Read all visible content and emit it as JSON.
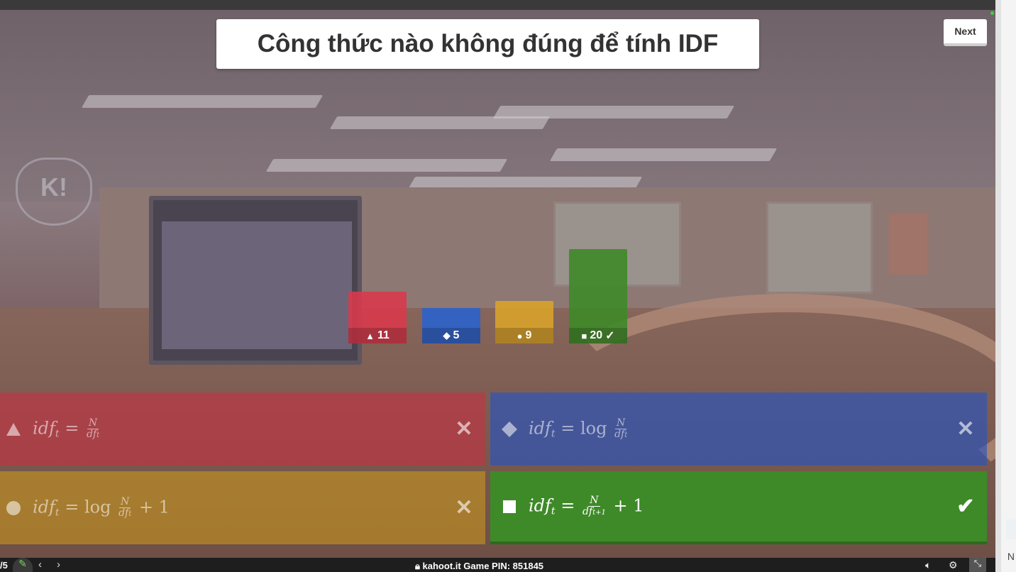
{
  "question": {
    "title": "Công thức nào không đúng để tính IDF"
  },
  "next_button": {
    "label": "Next"
  },
  "chart_data": {
    "type": "bar",
    "categories": [
      "triangle",
      "diamond",
      "circle",
      "square"
    ],
    "values": [
      11,
      5,
      9,
      20
    ],
    "colors": [
      "#d83a4c",
      "#2b62cc",
      "#d8a22b",
      "#3e8a28"
    ],
    "shape_icons": [
      "▲",
      "◆",
      "●",
      "■"
    ],
    "correct_marker": "✓",
    "correct_index": 3
  },
  "answers": [
    {
      "shape_icon": "triangle-icon",
      "lhs": "idf",
      "sub": "t",
      "eq": "=",
      "prefix": "",
      "num": "N",
      "den": "df",
      "den_sub": "t",
      "suffix": "",
      "mark": "✕",
      "correct": false
    },
    {
      "shape_icon": "diamond-icon",
      "lhs": "idf",
      "sub": "t",
      "eq": "=",
      "prefix": "log",
      "num": "N",
      "den": "df",
      "den_sub": "t",
      "suffix": "",
      "mark": "✕",
      "correct": false
    },
    {
      "shape_icon": "circle-icon",
      "lhs": "idf",
      "sub": "t",
      "eq": "=",
      "prefix": "log",
      "num": "N",
      "den": "df",
      "den_sub": "t",
      "suffix": "+ 1",
      "mark": "✕",
      "correct": false
    },
    {
      "shape_icon": "square-icon",
      "lhs": "idf",
      "sub": "t",
      "eq": "=",
      "prefix": "",
      "num": "N",
      "den": "df",
      "den_sub": "t+1",
      "suffix": "+ 1",
      "mark": "✔",
      "correct": true
    }
  ],
  "footer": {
    "question_count": "/5",
    "nav_prev": "‹",
    "nav_next": "›",
    "pin_text": "kahoot.it  Game PIN:  851845",
    "lock_icon": "lock-icon",
    "volume_icon": "volume-icon",
    "settings_icon": "gear-icon",
    "fullscreen_icon": "exit-fullscreen-icon"
  },
  "side_panel": {
    "text": "N"
  },
  "background": {
    "logo_text": "K!"
  }
}
